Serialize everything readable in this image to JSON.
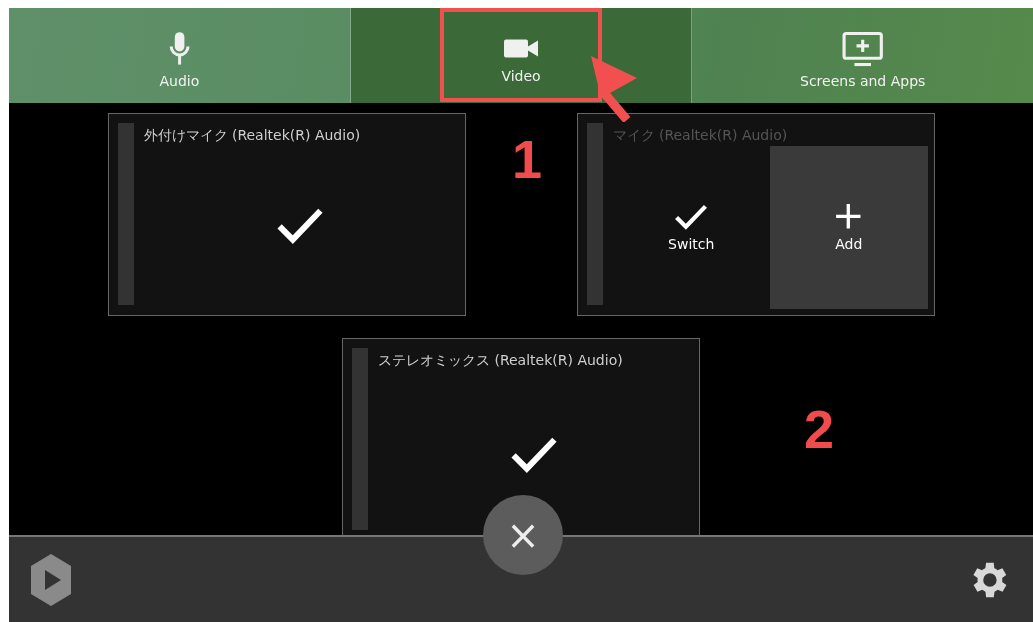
{
  "tabs": [
    {
      "label": "Audio",
      "selected": false
    },
    {
      "label": "Video",
      "selected": true
    },
    {
      "label": "Screens and Apps",
      "selected": false
    }
  ],
  "devices": [
    {
      "name": "外付けマイク (Realtek(R) Audio)",
      "kind": "selected"
    },
    {
      "name": "マイク (Realtek(R) Audio)",
      "kind": "options",
      "actions": [
        {
          "label": "Switch"
        },
        {
          "label": "Add"
        }
      ]
    },
    {
      "name": "ステレオミックス (Realtek(R) Audio)",
      "kind": "selected"
    }
  ],
  "close_button": {
    "label": "×"
  },
  "annotations": [
    {
      "label": "1"
    },
    {
      "label": "2"
    }
  ]
}
